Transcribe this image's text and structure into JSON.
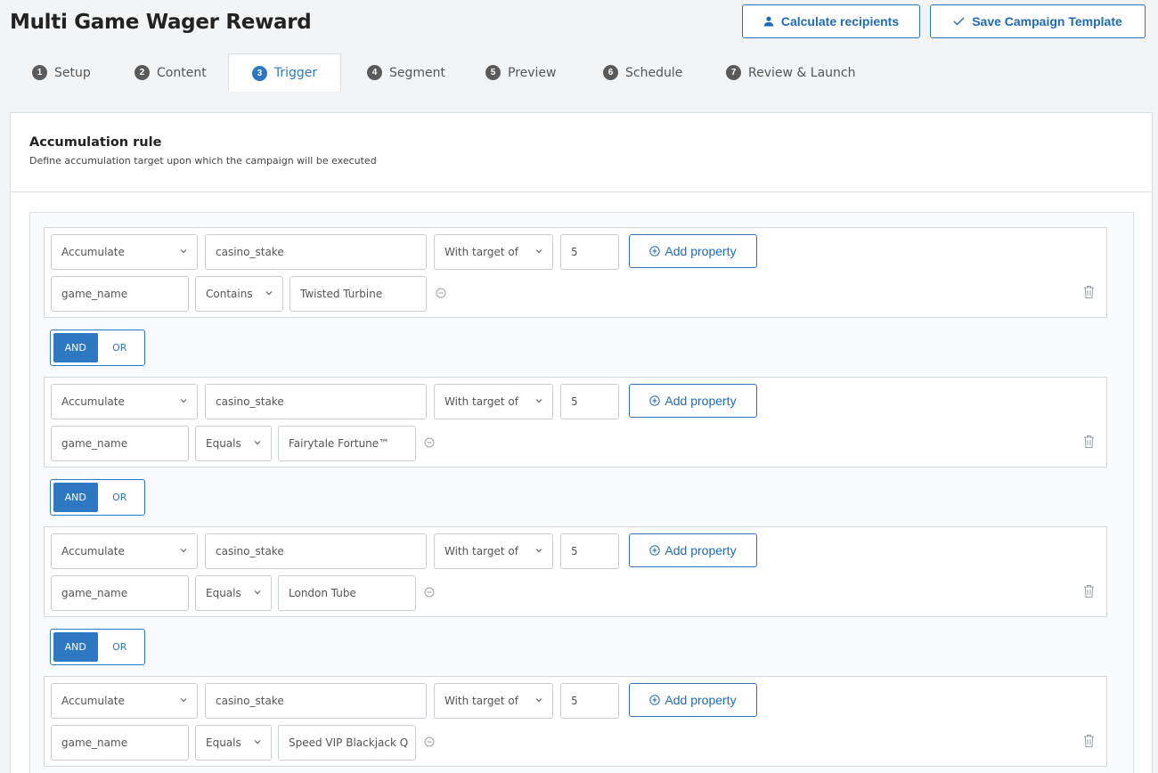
{
  "header": {
    "title": "Multi Game Wager Reward",
    "calculate_label": "Calculate recipients",
    "save_label": "Save Campaign Template"
  },
  "tabs": [
    {
      "num": "1",
      "label": "Setup"
    },
    {
      "num": "2",
      "label": "Content"
    },
    {
      "num": "3",
      "label": "Trigger",
      "active": true
    },
    {
      "num": "4",
      "label": "Segment"
    },
    {
      "num": "5",
      "label": "Preview"
    },
    {
      "num": "6",
      "label": "Schedule"
    },
    {
      "num": "7",
      "label": "Review & Launch"
    }
  ],
  "section": {
    "title": "Accumulation rule",
    "subtitle": "Define accumulation target upon which the campaign will be executed"
  },
  "add_property_label": "Add property",
  "rules": [
    {
      "action": "Accumulate",
      "metric": "casino_stake",
      "target_mode": "With target of",
      "target_value": "5",
      "property": "game_name",
      "operator": "Contains",
      "value": "Twisted Turbine"
    },
    {
      "action": "Accumulate",
      "metric": "casino_stake",
      "target_mode": "With target of",
      "target_value": "5",
      "property": "game_name",
      "operator": "Equals",
      "value": "Fairytale Fortune™"
    },
    {
      "action": "Accumulate",
      "metric": "casino_stake",
      "target_mode": "With target of",
      "target_value": "5",
      "property": "game_name",
      "operator": "Equals",
      "value": "London Tube"
    },
    {
      "action": "Accumulate",
      "metric": "casino_stake",
      "target_mode": "With target of",
      "target_value": "5",
      "property": "game_name",
      "operator": "Equals",
      "value": "Speed VIP Blackjack Q"
    }
  ],
  "connectors": [
    {
      "and_label": "AND",
      "or_label": "OR",
      "selected": "AND"
    },
    {
      "and_label": "AND",
      "or_label": "OR",
      "selected": "AND"
    },
    {
      "and_label": "AND",
      "or_label": "OR",
      "selected": "AND"
    }
  ],
  "colors": {
    "accent": "#2e78c2",
    "border": "#dde1e5"
  }
}
